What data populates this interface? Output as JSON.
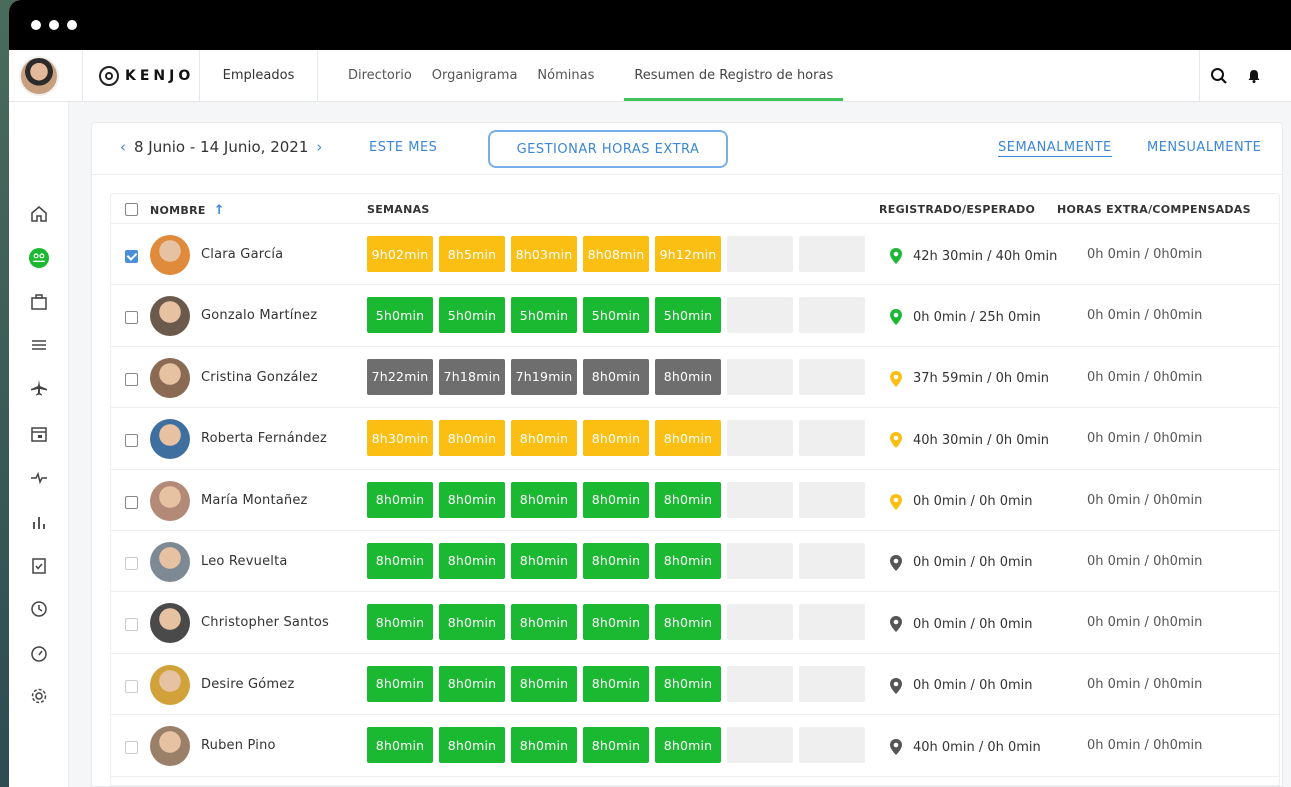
{
  "app": {
    "brand": "KENJO"
  },
  "nav": {
    "section": "Empleados",
    "tabs": [
      "Directorio",
      "Organigrama",
      "Nóminas",
      "Resumen de Registro de horas"
    ],
    "active_tab": "Resumen de Registro de horas"
  },
  "toolbar": {
    "date_range": "8 Junio - 14 Junio, 2021",
    "este_mes": "ESTE MES",
    "gestionar": "GESTIONAR HORAS EXTRA",
    "semanalmente": "SEMANALMENTE",
    "mensualmente": "MENSUALMENTE"
  },
  "table": {
    "headers": {
      "nombre": "NOMBRE",
      "semanas": "SEMANAS",
      "registrado": "REGISTRADO/ESPERADO",
      "horas_extra": "HORAS EXTRA/COMPENSADAS"
    },
    "rows": [
      {
        "name": "Clara García",
        "check": "checked",
        "chips": [
          "9h02min",
          "8h5min",
          "8h03min",
          "8h08min",
          "9h12min"
        ],
        "chip_color": "yellow",
        "pin": "green",
        "registrado": "42h 30min / 40h 0min",
        "horas": "0h 0min / 0h0min",
        "avatar_color": "#e08a3c"
      },
      {
        "name": "Gonzalo Martínez",
        "check": "unchecked",
        "chips": [
          "5h0min",
          "5h0min",
          "5h0min",
          "5h0min",
          "5h0min"
        ],
        "chip_color": "green",
        "pin": "green",
        "registrado": "0h 0min / 25h 0min",
        "horas": "0h 0min / 0h0min",
        "avatar_color": "#6b5a4c"
      },
      {
        "name": "Cristina González",
        "check": "unchecked",
        "chips": [
          "7h22min",
          "7h18min",
          "7h19min",
          "8h0min",
          "8h0min"
        ],
        "chip_color": "gray",
        "pin": "yellow",
        "registrado": "37h 59min / 0h 0min",
        "horas": "0h 0min / 0h0min",
        "avatar_color": "#8a6a52"
      },
      {
        "name": "Roberta Fernández",
        "check": "unchecked",
        "chips": [
          "8h30min",
          "8h0min",
          "8h0min",
          "8h0min",
          "8h0min"
        ],
        "chip_color": "yellow",
        "pin": "yellow",
        "registrado": "40h 30min / 0h 0min",
        "horas": "0h 0min / 0h0min",
        "avatar_color": "#3f6f9e"
      },
      {
        "name": "María Montañez",
        "check": "unchecked",
        "chips": [
          "8h0min",
          "8h0min",
          "8h0min",
          "8h0min",
          "8h0min"
        ],
        "chip_color": "green",
        "pin": "yellow",
        "registrado": "0h 0min / 0h 0min",
        "horas": "0h 0min / 0h0min",
        "avatar_color": "#b38a78"
      },
      {
        "name": "Leo Revuelta",
        "check": "disabled",
        "chips": [
          "8h0min",
          "8h0min",
          "8h0min",
          "8h0min",
          "8h0min"
        ],
        "chip_color": "green",
        "pin": "gray",
        "registrado": "0h 0min / 0h 0min",
        "horas": "0h 0min / 0h0min",
        "avatar_color": "#7d8a96"
      },
      {
        "name": "Christopher Santos",
        "check": "disabled",
        "chips": [
          "8h0min",
          "8h0min",
          "8h0min",
          "8h0min",
          "8h0min"
        ],
        "chip_color": "green",
        "pin": "gray",
        "registrado": "0h 0min / 0h 0min",
        "horas": "0h 0min / 0h0min",
        "avatar_color": "#4a4a4a"
      },
      {
        "name": "Desire Gómez",
        "check": "disabled",
        "chips": [
          "8h0min",
          "8h0min",
          "8h0min",
          "8h0min",
          "8h0min"
        ],
        "chip_color": "green",
        "pin": "gray",
        "registrado": "0h 0min / 0h 0min",
        "horas": "0h 0min / 0h0min",
        "avatar_color": "#d1a23a"
      },
      {
        "name": "Ruben Pino",
        "check": "disabled",
        "chips": [
          "8h0min",
          "8h0min",
          "8h0min",
          "8h0min",
          "8h0min"
        ],
        "chip_color": "green",
        "pin": "gray",
        "registrado": "40h 0min / 0h 0min",
        "horas": "0h 0min / 0h0min",
        "avatar_color": "#9a8068"
      }
    ]
  },
  "icons": {
    "sidebar": [
      "home-icon",
      "people-icon",
      "briefcase-icon",
      "list-icon",
      "plane-icon",
      "calendar-icon",
      "pulse-icon",
      "bar-chart-icon",
      "clipboard-check-icon",
      "clock-icon",
      "gauge-icon",
      "gear-icon"
    ],
    "topbar": [
      "search-icon",
      "bell-icon"
    ]
  },
  "colors": {
    "accent": "#3b86d6",
    "green": "#1bb832",
    "yellow": "#fbbf13",
    "gray": "#6e6e6e",
    "active_tab": "#3fc45a"
  }
}
